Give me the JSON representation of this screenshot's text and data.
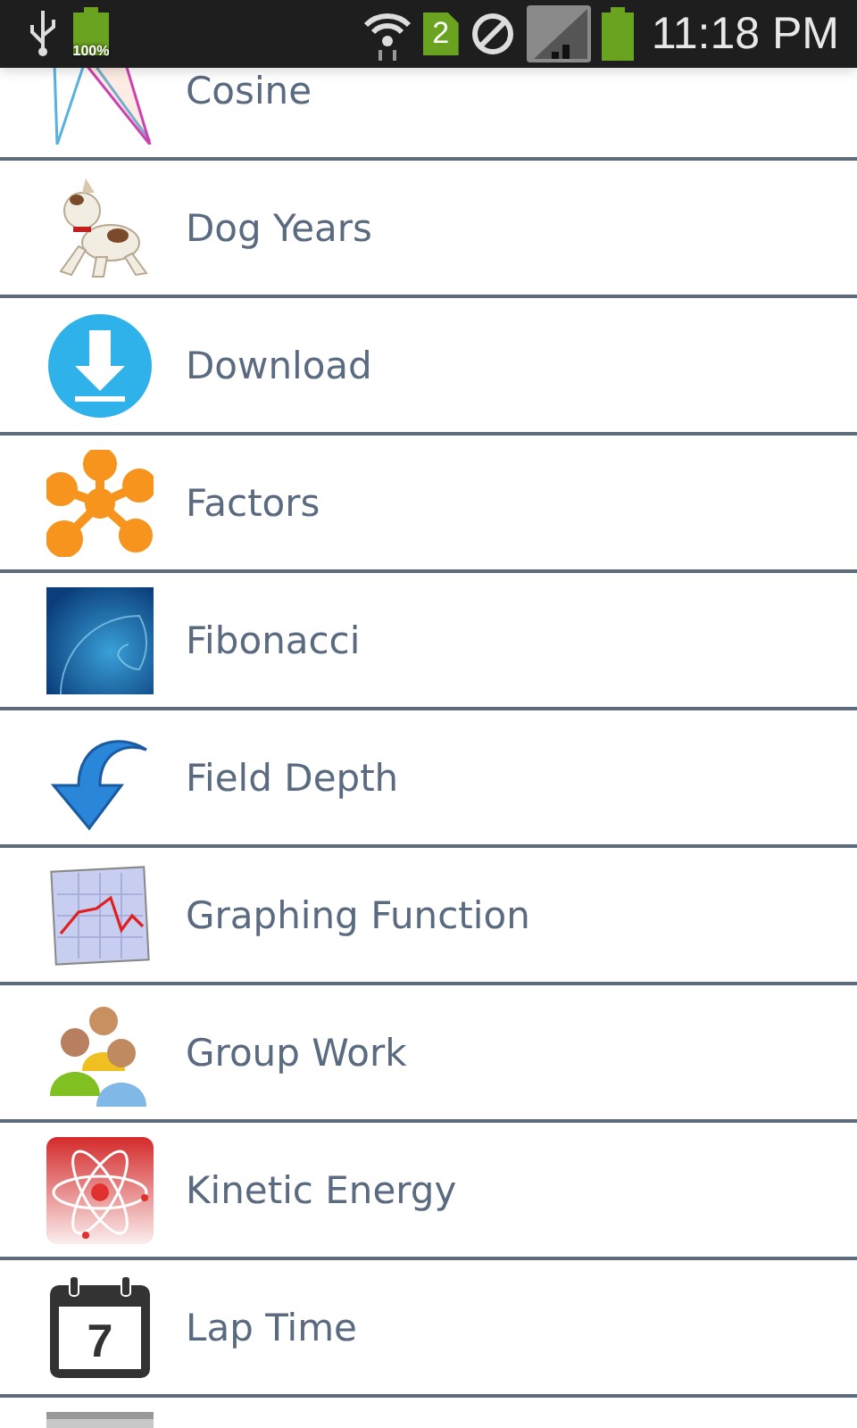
{
  "status_bar": {
    "battery_label": "100%",
    "sim_slot": "2",
    "time": "11:18 PM"
  },
  "items": [
    {
      "label": "Cosine"
    },
    {
      "label": "Dog Years"
    },
    {
      "label": "Download"
    },
    {
      "label": "Factors"
    },
    {
      "label": "Fibonacci"
    },
    {
      "label": "Field Depth"
    },
    {
      "label": "Graphing Function"
    },
    {
      "label": "Group Work"
    },
    {
      "label": "Kinetic Energy"
    },
    {
      "label": "Lap Time",
      "icon_text": "7"
    }
  ]
}
